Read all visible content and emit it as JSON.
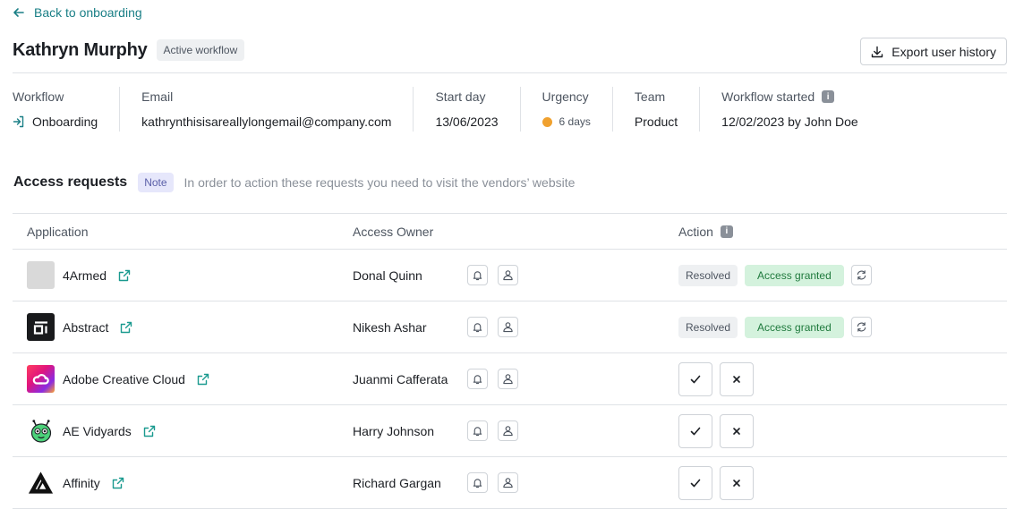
{
  "back_link": {
    "label": "Back to onboarding"
  },
  "user": {
    "name": "Kathryn Murphy",
    "status": "Active workflow"
  },
  "export": {
    "label": "Export user history"
  },
  "info": {
    "workflow_label": "Workflow",
    "workflow_value": "Onboarding",
    "email_label": "Email",
    "email_value": "kathrynthisisareallylongemail@company.com",
    "start_label": "Start day",
    "start_value": "13/06/2023",
    "urgency_label": "Urgency",
    "urgency_value": "6 days",
    "team_label": "Team",
    "team_value": "Product",
    "started_label": "Workflow started",
    "started_value": "12/02/2023 by John Doe"
  },
  "section": {
    "title": "Access requests",
    "note_badge": "Note",
    "note_text": "In order to action these requests you need to visit the vendors’ website"
  },
  "table": {
    "headers": {
      "application": "Application",
      "owner": "Access Owner",
      "action": "Action"
    },
    "rows": [
      {
        "app": "4Armed",
        "owner": "Donal Quinn",
        "state": "granted",
        "resolved_label": "Resolved",
        "granted_label": "Access granted",
        "logo": "gray-placeholder-logo"
      },
      {
        "app": "Abstract",
        "owner": "Nikesh Ashar",
        "state": "granted",
        "resolved_label": "Resolved",
        "granted_label": "Access granted",
        "logo": "abstract-logo"
      },
      {
        "app": "Adobe Creative Cloud",
        "owner": "Juanmi Cafferata",
        "state": "pending",
        "logo": "adobe-cc-logo"
      },
      {
        "app": "AE Vidyards",
        "owner": "Harry Johnson",
        "state": "pending",
        "logo": "vidyard-robot-logo"
      },
      {
        "app": "Affinity",
        "owner": "Richard Gargan",
        "state": "pending",
        "logo": "affinity-logo"
      }
    ]
  },
  "colors": {
    "link": "#1a7f86",
    "urgency": "#f0a12f",
    "granted_bg": "#d4f2dd",
    "note_bg": "#e6e7fb"
  }
}
